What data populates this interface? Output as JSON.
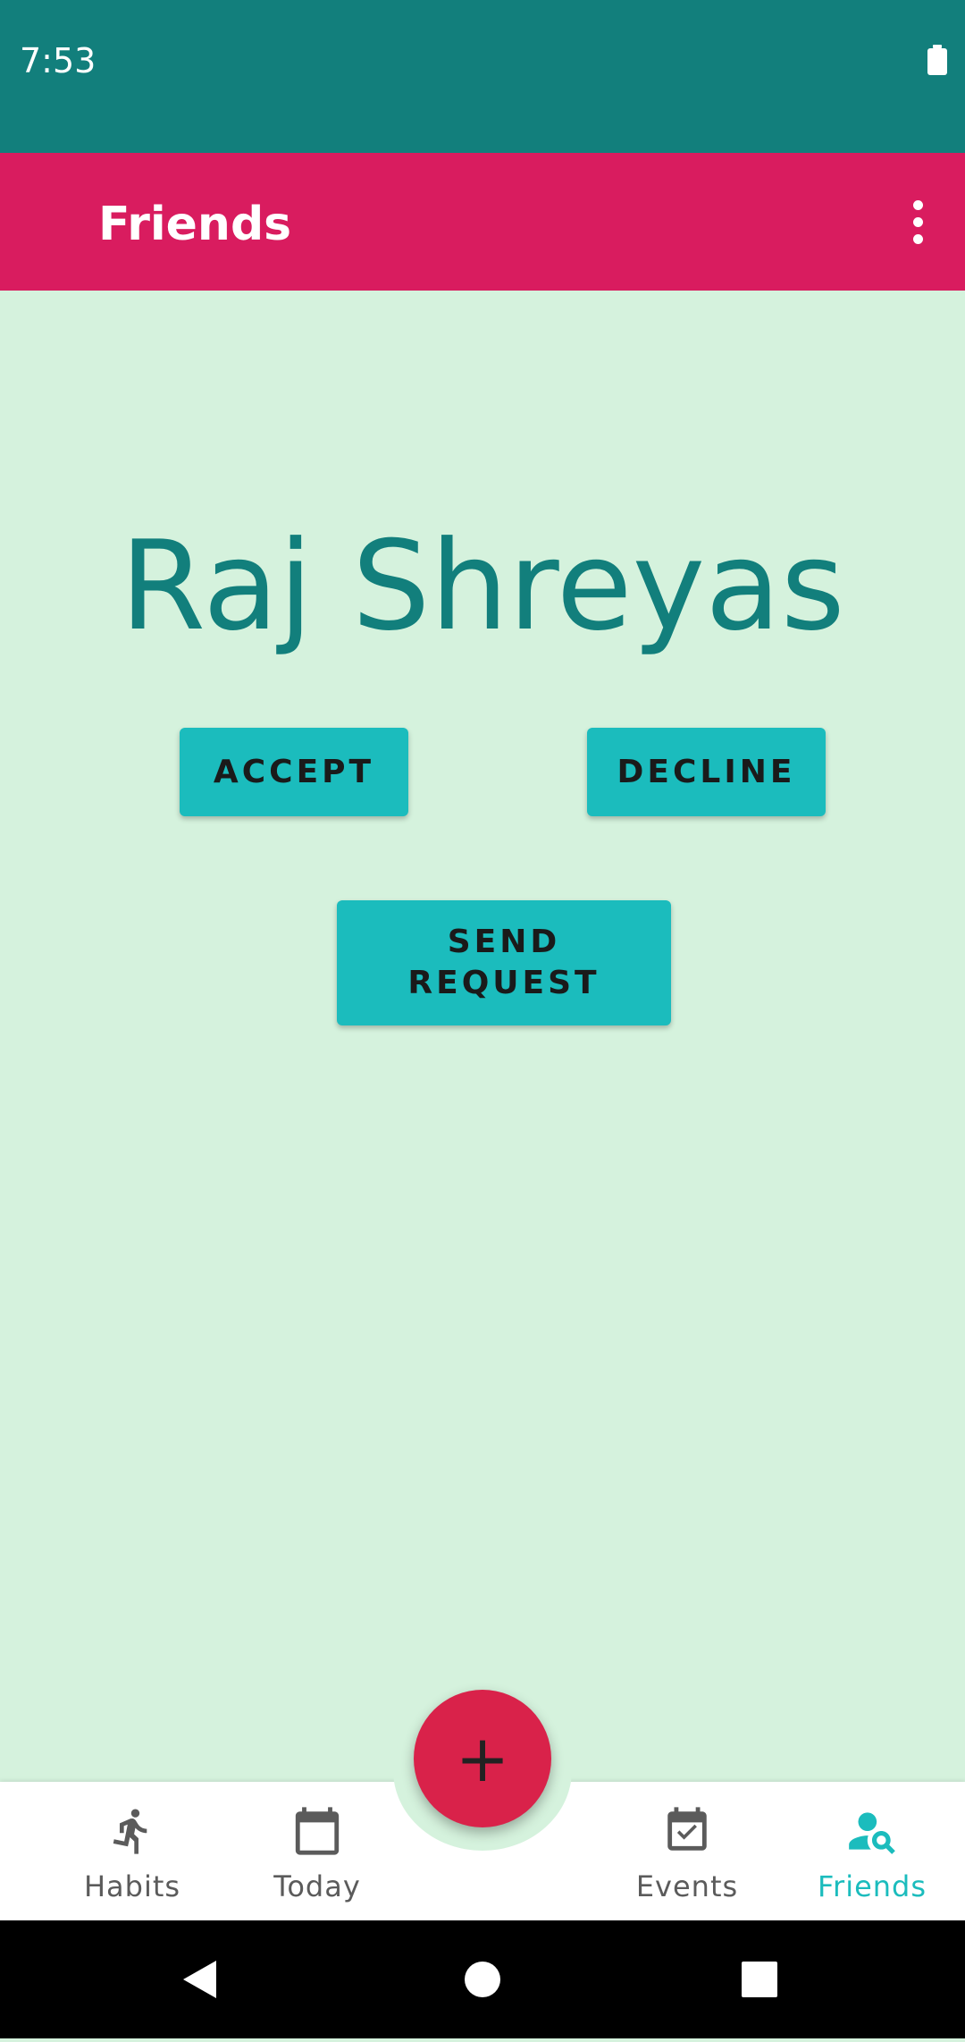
{
  "status_bar": {
    "time": "7:53"
  },
  "app_bar": {
    "title": "Friends"
  },
  "main": {
    "friend_name": "Raj Shreyas",
    "accept_label": "ACCEPT",
    "decline_label": "DECLINE",
    "send_request_label": "SEND REQUEST"
  },
  "bottom_nav": {
    "items": [
      {
        "label": "Habits",
        "icon": "run-icon",
        "active": false
      },
      {
        "label": "Today",
        "icon": "calendar-icon",
        "active": false
      },
      {
        "label": "Events",
        "icon": "calendar-check-icon",
        "active": false
      },
      {
        "label": "Friends",
        "icon": "person-search-icon",
        "active": true
      }
    ],
    "fab_icon": "plus-icon"
  },
  "colors": {
    "status_bar": "#127f7c",
    "app_bar": "#d91c5f",
    "background": "#d5f2dd",
    "button": "#1bbcbd",
    "name_text": "#127f7c",
    "fab": "#d9224a",
    "active_nav": "#1bbcbd"
  }
}
